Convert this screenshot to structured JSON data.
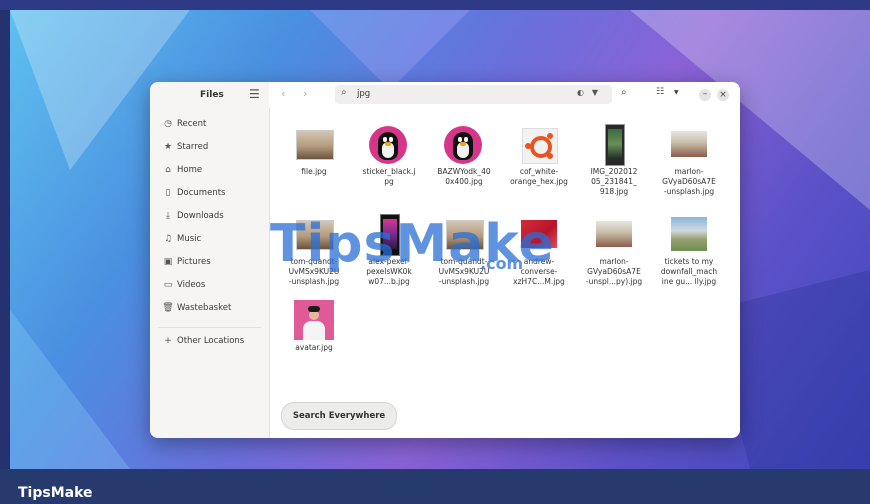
{
  "window": {
    "sidebar_title": "Files"
  },
  "sidebar": {
    "items": [
      {
        "label": "Recent",
        "icon": "clock-icon"
      },
      {
        "label": "Starred",
        "icon": "star-icon"
      },
      {
        "label": "Home",
        "icon": "home-icon"
      },
      {
        "label": "Documents",
        "icon": "document-icon"
      },
      {
        "label": "Downloads",
        "icon": "download-icon"
      },
      {
        "label": "Music",
        "icon": "music-icon"
      },
      {
        "label": "Pictures",
        "icon": "picture-icon"
      },
      {
        "label": "Videos",
        "icon": "video-icon"
      },
      {
        "label": "Wastebasket",
        "icon": "trash-icon"
      }
    ],
    "other": {
      "label": "Other Locations",
      "icon": "plus-icon"
    }
  },
  "search": {
    "query": "jpg"
  },
  "files": [
    {
      "name": "file.jpg"
    },
    {
      "name": "sticker_black.j\npg"
    },
    {
      "name": "BAZWYodk_40\n0x400.jpg"
    },
    {
      "name": "cof_white-\norange_hex.jpg"
    },
    {
      "name": "IMG_202012\n05_231841_\n918.jpg"
    },
    {
      "name": "marlon-\nGVyaD60sA7E\n-unsplash.jpg"
    },
    {
      "name": "tom-quandt-\nUvMSx9KU2U\n-unsplash.jpg"
    },
    {
      "name": "alex-pexel-\npexelsWK0k\nw07...b.jpg"
    },
    {
      "name": "tom-quandt-\nUvMSx9KU2U\n-unsplash.jpg"
    },
    {
      "name": "andrew-\nconverse-\nxzH7C...M.jpg"
    },
    {
      "name": "marlon-\nGVyaD60sA7E\n-unspl...py).jpg"
    },
    {
      "name": "tickets to my\ndownfall_mach\nine gu... lly.jpg"
    },
    {
      "name": "avatar.jpg"
    }
  ],
  "actions": {
    "search_everywhere": "Search Everywhere"
  },
  "watermark": {
    "main": "TipsMake",
    "suffix": ".com"
  },
  "footer": {
    "brand": "TipsMake"
  },
  "colors": {
    "accent": "#2a6fd6",
    "footer": "#273a6e"
  }
}
